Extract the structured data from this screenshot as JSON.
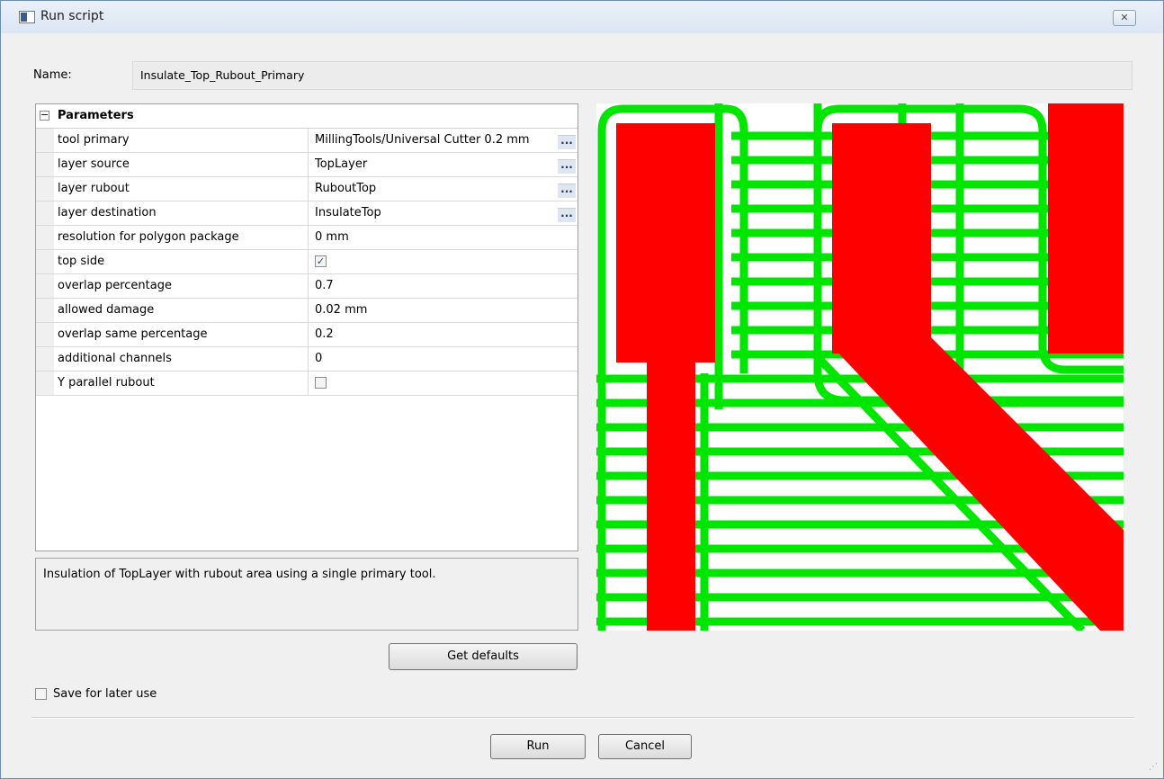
{
  "window": {
    "title": "Run script",
    "close_icon": "close-icon",
    "close_glyph": "✕"
  },
  "name": {
    "label": "Name:",
    "value": "Insulate_Top_Rubout_Primary"
  },
  "parameters": {
    "header": "Parameters",
    "rows": [
      {
        "key": "tool primary",
        "value": "MillingTools/Universal Cutter 0.2 mm",
        "has_browse": true
      },
      {
        "key": "layer source",
        "value": "TopLayer",
        "has_browse": true
      },
      {
        "key": "layer rubout",
        "value": "RuboutTop",
        "has_browse": true
      },
      {
        "key": "layer destination",
        "value": "InsulateTop",
        "has_browse": true
      },
      {
        "key": "resolution for polygon package",
        "value": "0 mm"
      },
      {
        "key": "top side",
        "checkbox": true,
        "checked": true
      },
      {
        "key": "overlap percentage",
        "value": "0.7"
      },
      {
        "key": "allowed damage",
        "value": "0.02 mm"
      },
      {
        "key": "overlap same percentage",
        "value": "0.2"
      },
      {
        "key": "additional channels",
        "value": "0"
      },
      {
        "key": "Y parallel rubout",
        "checkbox": true,
        "checked": false
      }
    ],
    "browse_label": "..."
  },
  "description": "Insulation of TopLayer with rubout area using a single primary tool.",
  "buttons": {
    "get_defaults": "Get defaults",
    "run": "Run",
    "cancel": "Cancel"
  },
  "save_for_later": {
    "label": "Save for later use",
    "checked": false
  },
  "preview": {
    "colors": {
      "copper": "#ff0000",
      "rubout": "#00e600",
      "background": "#ffffff"
    }
  }
}
